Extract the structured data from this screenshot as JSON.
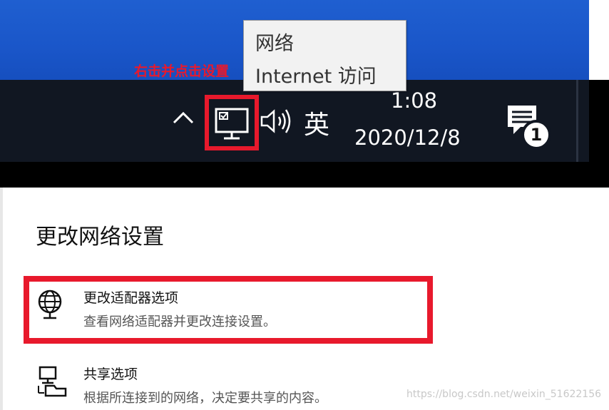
{
  "tooltip": {
    "title": "网络",
    "subtitle": "Internet 访问"
  },
  "annotation": {
    "text": "右击并点击设置",
    "color": "#e8192c"
  },
  "taskbar": {
    "show_hidden_icon": "chevron-up-icon",
    "network_icon": "network-monitor-icon",
    "volume_icon": "speaker-icon",
    "ime_label": "英",
    "clock_time": "1:08",
    "clock_date": "2020/12/8",
    "notification_count": "1"
  },
  "panel": {
    "title": "更改网络设置",
    "options": [
      {
        "icon": "globe-adapter-icon",
        "title": "更改适配器选项",
        "description": "查看网络适配器并更改连接设置。"
      },
      {
        "icon": "sharing-icon",
        "title": "共享选项",
        "description": "根据所连接到的网络，决定要共享的内容。"
      }
    ]
  },
  "watermark": "https://blog.csdn.net/weixin_51622156",
  "colors": {
    "desktop": "#1a56c9",
    "taskbar": "#111722",
    "highlight": "#e8192c"
  }
}
